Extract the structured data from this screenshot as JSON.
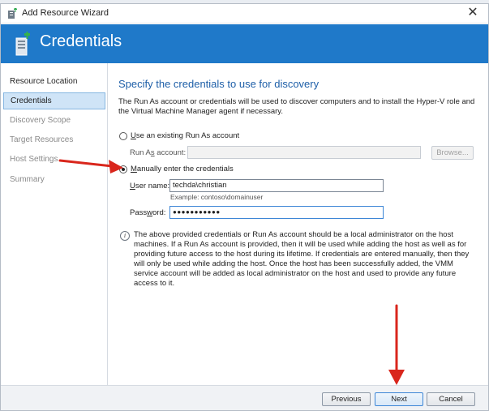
{
  "window": {
    "title": "Add Resource Wizard",
    "close_label": "✕"
  },
  "banner": {
    "title": "Credentials"
  },
  "steps": [
    {
      "label": "Resource Location",
      "state": "normal"
    },
    {
      "label": "Credentials",
      "state": "active"
    },
    {
      "label": "Discovery Scope",
      "state": "disabled"
    },
    {
      "label": "Target Resources",
      "state": "disabled"
    },
    {
      "label": "Host Settings",
      "state": "disabled"
    },
    {
      "label": "Summary",
      "state": "disabled"
    }
  ],
  "main": {
    "heading": "Specify the credentials to use for discovery",
    "description": "The Run As account or credentials will be used to discover computers and to install the Hyper-V role and the Virtual Machine Manager agent if necessary.",
    "option_existing": {
      "prefix": "U",
      "rest": "se an existing Run As account",
      "selected": false
    },
    "runas_label_a": "Run A",
    "runas_label_u": "s",
    "runas_label_b": " account:",
    "runas_value": "",
    "browse_label": "Browse...",
    "option_manual": {
      "prefix": "M",
      "rest": "anually enter the credentials",
      "selected": true
    },
    "username_label_u": "U",
    "username_label_rest": "ser name:",
    "username_value": "techda\\christian",
    "username_example": "Example: contoso\\domainuser",
    "password_label_a": "Pass",
    "password_label_u": "w",
    "password_label_b": "ord:",
    "password_value": "●●●●●●●●●●●",
    "info_icon": "i",
    "note": "The above provided credentials or Run As account should be a local administrator on the host machines. If a Run As account is provided, then it will be used while adding the host as well as for providing future access to the host during its lifetime. If credentials are entered manually, then they will only be used while adding the host. Once the host has been successfully added, the VMM service account will be added as local administrator on the host and used to provide any future access to it."
  },
  "footer": {
    "previous_label": "Previous",
    "next_label": "Next",
    "cancel_label": "Cancel"
  },
  "colors": {
    "banner": "#1f79c9",
    "heading": "#1e5fa8",
    "arrow": "#d9261c"
  }
}
